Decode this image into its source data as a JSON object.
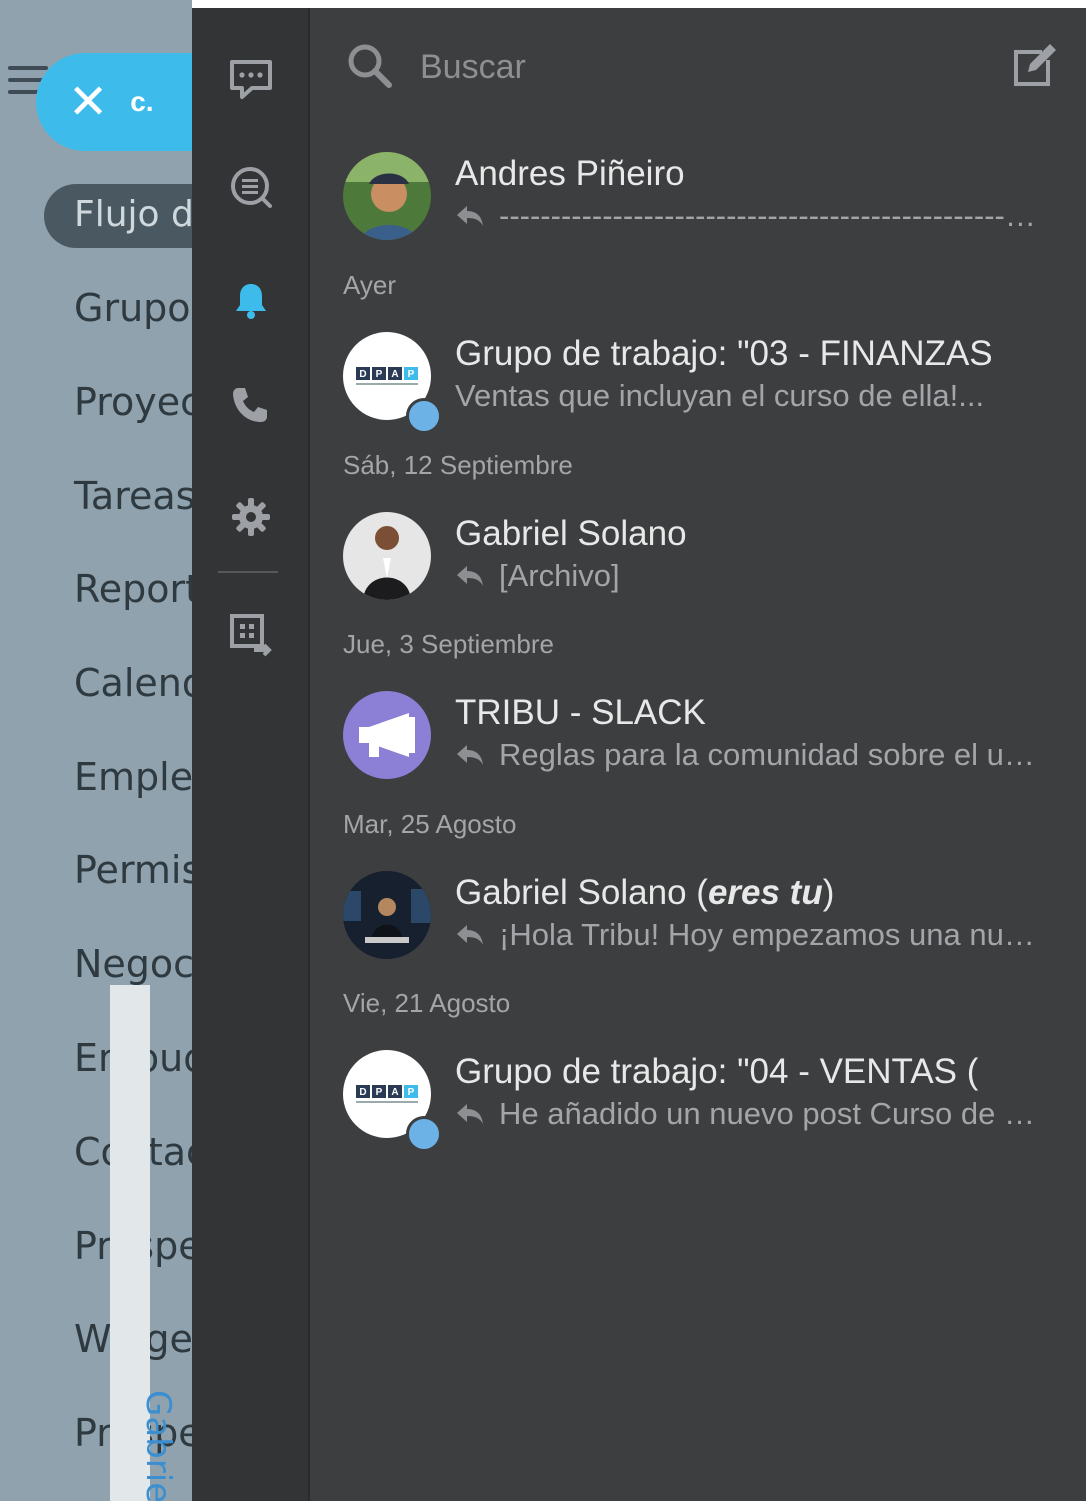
{
  "background_app": {
    "close_label": "c.",
    "flujo_label": "Flujo d",
    "menu_items": [
      "Grupos",
      "Proyec",
      "Tareas",
      "Report",
      "Calend",
      "Emple",
      "Permis",
      "Negoci",
      "Embud",
      "Contac",
      "Prospe",
      "Widget",
      "Prospe"
    ],
    "signature": "Gabriel S"
  },
  "rail": {
    "icons": [
      "chat-bubble-icon",
      "chat-list-icon",
      "bell-icon",
      "phone-icon",
      "gear-icon",
      "screen-share-icon"
    ],
    "active_icon": "bell-icon",
    "active_color": "#3dbcec"
  },
  "search": {
    "placeholder": "Buscar"
  },
  "chats": [
    {
      "name": "Andres Piñeiro",
      "preview": "-------------------------------------------------------",
      "avatar": "photo"
    },
    {
      "date": "Ayer",
      "name": "Grupo de trabajo: \"03 - FINANZAS",
      "preview": "Ventas que incluyan el curso de ella!...",
      "avatar": "logo"
    },
    {
      "date": "Sáb, 12 Septiembre",
      "name": "Gabriel Solano",
      "preview": "[Archivo]",
      "avatar": "photo"
    },
    {
      "date": "Jue, 3 Septiembre",
      "name": "TRIBU - SLACK",
      "preview": "Reglas para la comunidad sobre el uso de Slack",
      "avatar": "megaphone"
    },
    {
      "date": "Mar, 25 Agosto",
      "name": "Gabriel Solano",
      "name_suffix": "eres tu",
      "preview": "¡Hola Tribu! Hoy empezamos una nueva etapa",
      "avatar": "photo"
    },
    {
      "date": "Vie, 21 Agosto",
      "name": "Grupo de trabajo: \"04 - VENTAS (",
      "preview": "He añadido un nuevo post Curso de ventas",
      "avatar": "logo"
    }
  ],
  "logo_text": "DPAP",
  "colors": {
    "accent": "#3dbcec",
    "panel": "#3d3e40",
    "rail": "#333436",
    "megaphone_bg": "#8b7fd6"
  }
}
